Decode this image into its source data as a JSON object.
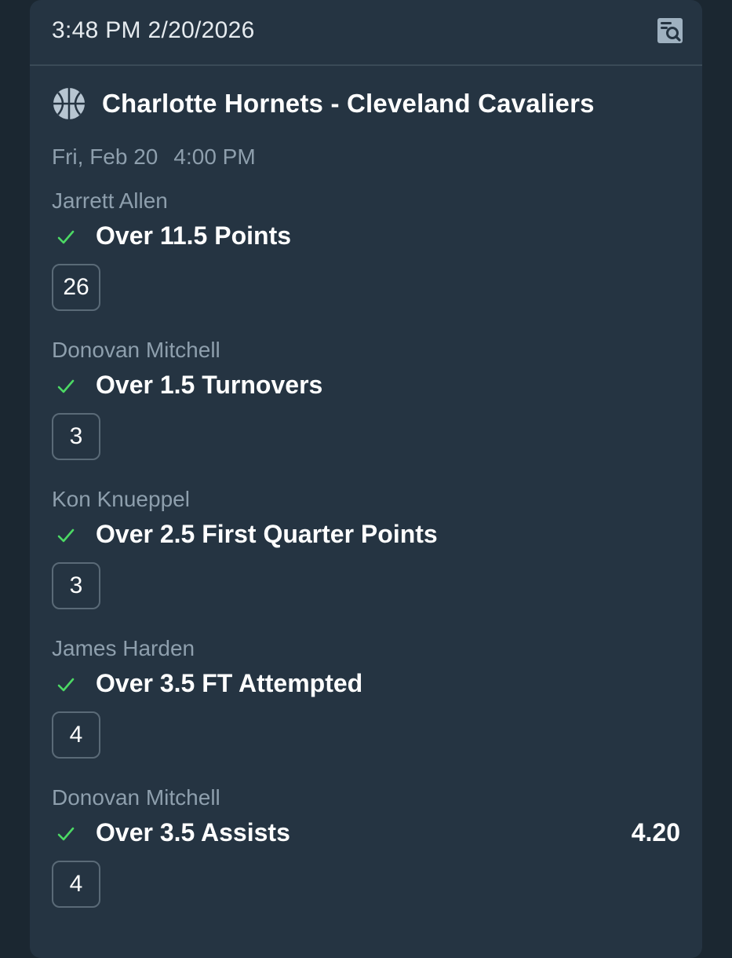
{
  "header": {
    "timestamp": "3:48 PM 2/20/2026",
    "action_icon": "search-document-icon"
  },
  "event": {
    "sport_icon": "basketball-icon",
    "title": "Charlotte Hornets - Cleveland Cavaliers",
    "date": "Fri, Feb 20",
    "time": "4:00 PM"
  },
  "legs": [
    {
      "player": "Jarrett Allen",
      "selection": "Over 11.5 Points",
      "result": "26",
      "odds": "",
      "status": "won"
    },
    {
      "player": "Donovan Mitchell",
      "selection": "Over 1.5 Turnovers",
      "result": "3",
      "odds": "",
      "status": "won"
    },
    {
      "player": "Kon Knueppel",
      "selection": "Over 2.5 First Quarter Points",
      "result": "3",
      "odds": "",
      "status": "won"
    },
    {
      "player": "James Harden",
      "selection": "Over 3.5 FT Attempted",
      "result": "4",
      "odds": "",
      "status": "won"
    },
    {
      "player": "Donovan Mitchell",
      "selection": "Over 3.5 Assists",
      "result": "4",
      "odds": "4.20",
      "status": "won"
    }
  ],
  "colors": {
    "background": "#1b2731",
    "card": "#253442",
    "check_green": "#4cd964",
    "muted_text": "#8e9fad"
  }
}
